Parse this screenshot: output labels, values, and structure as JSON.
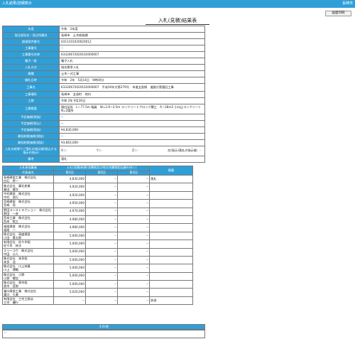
{
  "topbar": {
    "title": "入札結果/詳細表示",
    "right": "長崎市"
  },
  "print_button": "画面印刷",
  "page_title": "入札(見積)結果表",
  "info_rows": [
    {
      "label": "年度",
      "value": "令和　2年度"
    },
    {
      "label": "発注部局名／発注所属名",
      "value": "長崎市　土木総務課"
    },
    {
      "label": "調達案件番号",
      "value": "0311101020020012"
    },
    {
      "label": "工事番号",
      "value": "--"
    },
    {
      "label": "工事番号名称",
      "value": "K3320672020102000007"
    },
    {
      "label": "電子／紙",
      "value": "電子入札"
    },
    {
      "label": "入札方式",
      "value": "指名競争入札"
    },
    {
      "label": "業種",
      "value": "土木一式工事"
    },
    {
      "label": "開札日時",
      "value": "令和　2年　5月14日　9時00分"
    },
    {
      "label": "工事名",
      "value": "K3320672020102000007　平成30年災第279号　市道五島線　道路災害復旧工事"
    },
    {
      "label": "工事場所",
      "value": "長崎市　五島町　地内"
    },
    {
      "label": "工期",
      "value": "令和 2年 9月30日"
    },
    {
      "label": "工事概要",
      "value": "復旧延長　L＝77.5m 幅員　W=2.6~3.5m コンクリートブロック積工　A＝28m2 小口止コンクリート　N=2箇所"
    },
    {
      "label": "予定価格(税抜)",
      "value": "--"
    },
    {
      "label": "予定価格(税込)",
      "value": "--"
    },
    {
      "label": "予定価格(税抜)",
      "value": "¥4,830,000-"
    },
    {
      "label": "最低制限価格(税抜)",
      "value": "--"
    },
    {
      "label": "最低制限価格(税抜)",
      "value": "¥3,863,000-"
    },
    {
      "label": "入札の結果でご落札の指示順(税込する指示の指示)",
      "values": [
        "X＝-",
        "Y＝-",
        "Z＝-",
        "次(指示)落札の指示順：-"
      ]
    },
    {
      "label": "備考",
      "value": "落札"
    }
  ],
  "bids": {
    "head_company": "入札参加業者",
    "head_company_sub": "代表者名",
    "head_result": "入札(見積)結果(消費税及び地方消費税相当額を除く)",
    "head_round1": "第1回",
    "head_round2": "第2回",
    "head_round3": "第3回",
    "head_remark": "摘要",
    "rows": [
      {
        "company": "長崎建設工業　株式会社",
        "rep": "白石　将一",
        "r1": "4,830,000",
        "r2": "--",
        "r3": "--",
        "remark": "落札"
      },
      {
        "company": "株式会社　藤北産業",
        "rep": "藤田　健次",
        "r1": "4,920,000",
        "r2": "--",
        "r3": "--",
        "remark": ""
      },
      {
        "company": "中村建設　株式会社",
        "rep": "中村　良行",
        "r1": "4,920,000",
        "r2": "--",
        "r3": "--",
        "remark": ""
      },
      {
        "company": "宮崎建設　株式会社",
        "rep": "宮崎　悟",
        "r1": "4,950,000",
        "r2": "--",
        "r3": "--",
        "remark": ""
      },
      {
        "company": "野田コンストラクション　株式会社",
        "rep": "野田　一彦",
        "r1": "4,970,000",
        "r2": "--",
        "r3": "--",
        "remark": ""
      },
      {
        "company": "西本工業　株式会社",
        "rep": "西本　睦三",
        "r1": "4,980,000",
        "r2": "--",
        "r3": "--",
        "remark": ""
      },
      {
        "company": "福尾建設　株式会社",
        "rep": "福尾　一",
        "r1": "4,980,000",
        "r2": "--",
        "r3": "--",
        "remark": ""
      },
      {
        "company": "株式会社　高盛建設",
        "rep": "小田　貴太郎",
        "r1": "5,000,000",
        "r2": "--",
        "r3": "--",
        "remark": ""
      },
      {
        "company": "有限会社　佐々木組",
        "rep": "佐々木　林水",
        "r1": "5,000,000",
        "r2": "--",
        "r3": "--",
        "remark": ""
      },
      {
        "company": "スリーコウ　株式会社",
        "rep": "中田　公人",
        "r1": "5,000,000",
        "r2": "--",
        "r3": "--",
        "remark": ""
      },
      {
        "company": "株式会社　本多組",
        "rep": "本多　浩",
        "r1": "5,000,000",
        "r2": "--",
        "r3": "--",
        "remark": ""
      },
      {
        "company": "株式会社　川上林業",
        "rep": "川上　博暢",
        "r1": "5,000,000",
        "r2": "--",
        "r3": "--",
        "remark": ""
      },
      {
        "company": "株式会社　小野",
        "rep": "小野　敬信",
        "r1": "5,000,000",
        "r2": "--",
        "r3": "--",
        "remark": ""
      },
      {
        "company": "株式会社　恵木組",
        "rep": "恵木　宣郎",
        "r1": "5,000,000",
        "r2": "--",
        "r3": "--",
        "remark": ""
      },
      {
        "company": "瀧口建設工業　株式会社",
        "rep": "瀧口　久美",
        "r1": "5,020,000",
        "r2": "--",
        "r3": "--",
        "remark": ""
      },
      {
        "company": "有限会社　三宅工務店",
        "rep": "三宅　優行",
        "r1": "--",
        "r2": "--",
        "r3": "--",
        "remark": "辞退"
      }
    ]
  },
  "other": {
    "header": "その他",
    "value": "--"
  }
}
